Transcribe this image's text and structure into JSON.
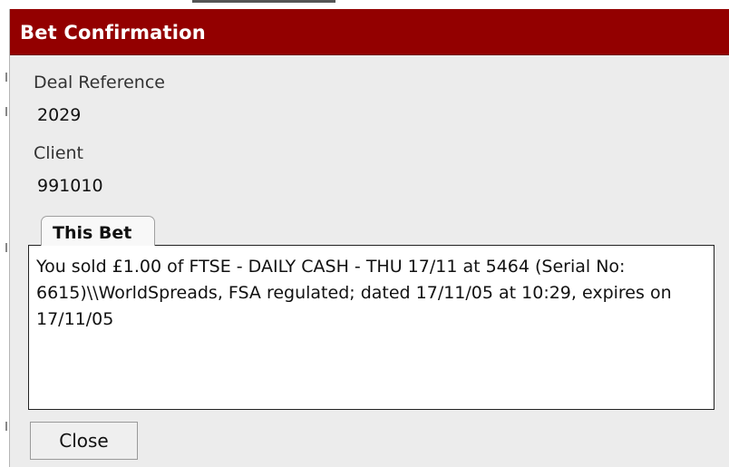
{
  "dialog": {
    "title": "Bet Confirmation",
    "title_bar_color": "#930000"
  },
  "deal_reference": {
    "label": "Deal Reference",
    "value": "2029"
  },
  "client": {
    "label": "Client",
    "value": "991010"
  },
  "bet": {
    "tab_label": "This Bet",
    "text": "You sold £1.00 of FTSE - DAILY CASH - THU 17/11 at 5464 (Serial No: 6615)\\\\WorldSpreads, FSA regulated; dated 17/11/05 at 10:29, expires on 17/11/05"
  },
  "actions": {
    "close_label": "Close"
  }
}
